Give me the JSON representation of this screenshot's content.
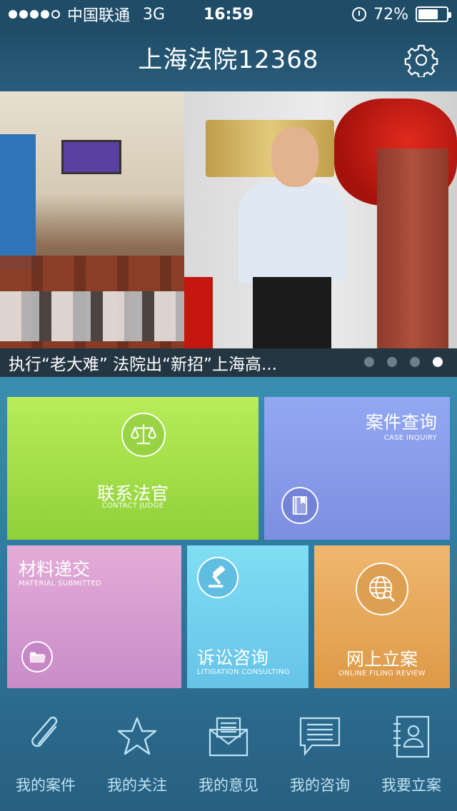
{
  "status_bar": {
    "carrier": "中国联通",
    "network": "3G",
    "time": "16:59",
    "battery": "72%",
    "battery_level": 0.72
  },
  "header": {
    "title": "上海法院12368",
    "settings_icon": "gear-icon"
  },
  "banner": {
    "caption": "执行“老大难” 法院出“新招”上海高...",
    "pages": 4,
    "active_page": 4
  },
  "tiles": {
    "contact_judge": {
      "cn": "联系法官",
      "en": "CONTACT JUDGE",
      "icon": "scales-icon"
    },
    "case_inquiry": {
      "cn": "案件查询",
      "en": "CASE INQUIRY",
      "icon": "book-icon"
    },
    "material_submitted": {
      "cn": "材料递交",
      "en": "MATERIAL SUBMITTED",
      "icon": "folder-icon"
    },
    "litigation_consulting": {
      "cn": "诉讼咨询",
      "en": "LITIGATION CONSULTING",
      "icon": "gavel-icon"
    },
    "online_filing": {
      "cn": "网上立案",
      "en": "ONLINE FILING REVIEW",
      "icon": "globe-search-icon"
    }
  },
  "tab_bar": {
    "items": [
      {
        "label": "我的案件",
        "icon": "paperclip-icon"
      },
      {
        "label": "我的关注",
        "icon": "star-icon"
      },
      {
        "label": "我的意见",
        "icon": "envelope-icon"
      },
      {
        "label": "我的咨询",
        "icon": "chat-icon"
      },
      {
        "label": "我要立案",
        "icon": "contact-book-icon"
      }
    ]
  },
  "colors": {
    "judge_tile": "#a6e04a",
    "case_tile": "#8799ea",
    "material_tile": "#d69ccf",
    "litigation_tile": "#72cfed",
    "online_tile": "#e6a85a"
  }
}
